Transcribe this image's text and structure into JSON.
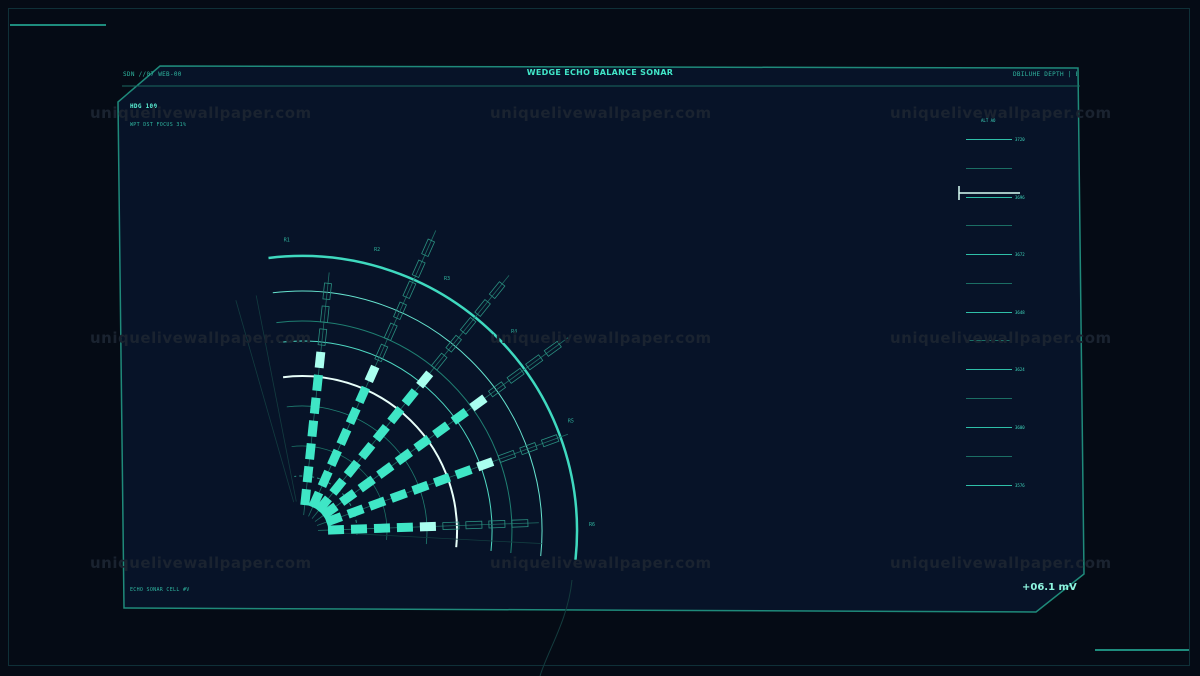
{
  "header": {
    "left_code": "SDN //07 WEB-00",
    "title": "WEDGE ECHO BALANCE SONAR",
    "right_code": "DBILUHE DEPTH | ECHO"
  },
  "panel": {
    "hdg": "HDG 100",
    "focus": "WPT DST FOCUS 31%",
    "footer_left": "ECHO SONAR CELL #V",
    "readout": "+06.1 mV"
  },
  "scale": {
    "label": "ALT AO",
    "values": [
      "3720",
      "3696",
      "3672",
      "3648",
      "3624",
      "3600",
      "3576"
    ]
  },
  "sonar": {
    "ring_labels": [
      "R1",
      "R2",
      "R3",
      "R4",
      "R5",
      "R6"
    ],
    "bars": [
      {
        "lit": 5,
        "total": 9
      },
      {
        "lit": 8,
        "total": 11
      },
      {
        "lit": 9,
        "total": 13
      },
      {
        "lit": 8,
        "total": 13
      },
      {
        "lit": 7,
        "total": 13
      },
      {
        "lit": 7,
        "total": 10
      }
    ]
  },
  "watermark": "uniquelivewallpaper.com",
  "colors": {
    "accent": "#3fd9bf",
    "bright": "#8ff5e0",
    "panel_bg": "#071328",
    "background": "#050b15"
  }
}
